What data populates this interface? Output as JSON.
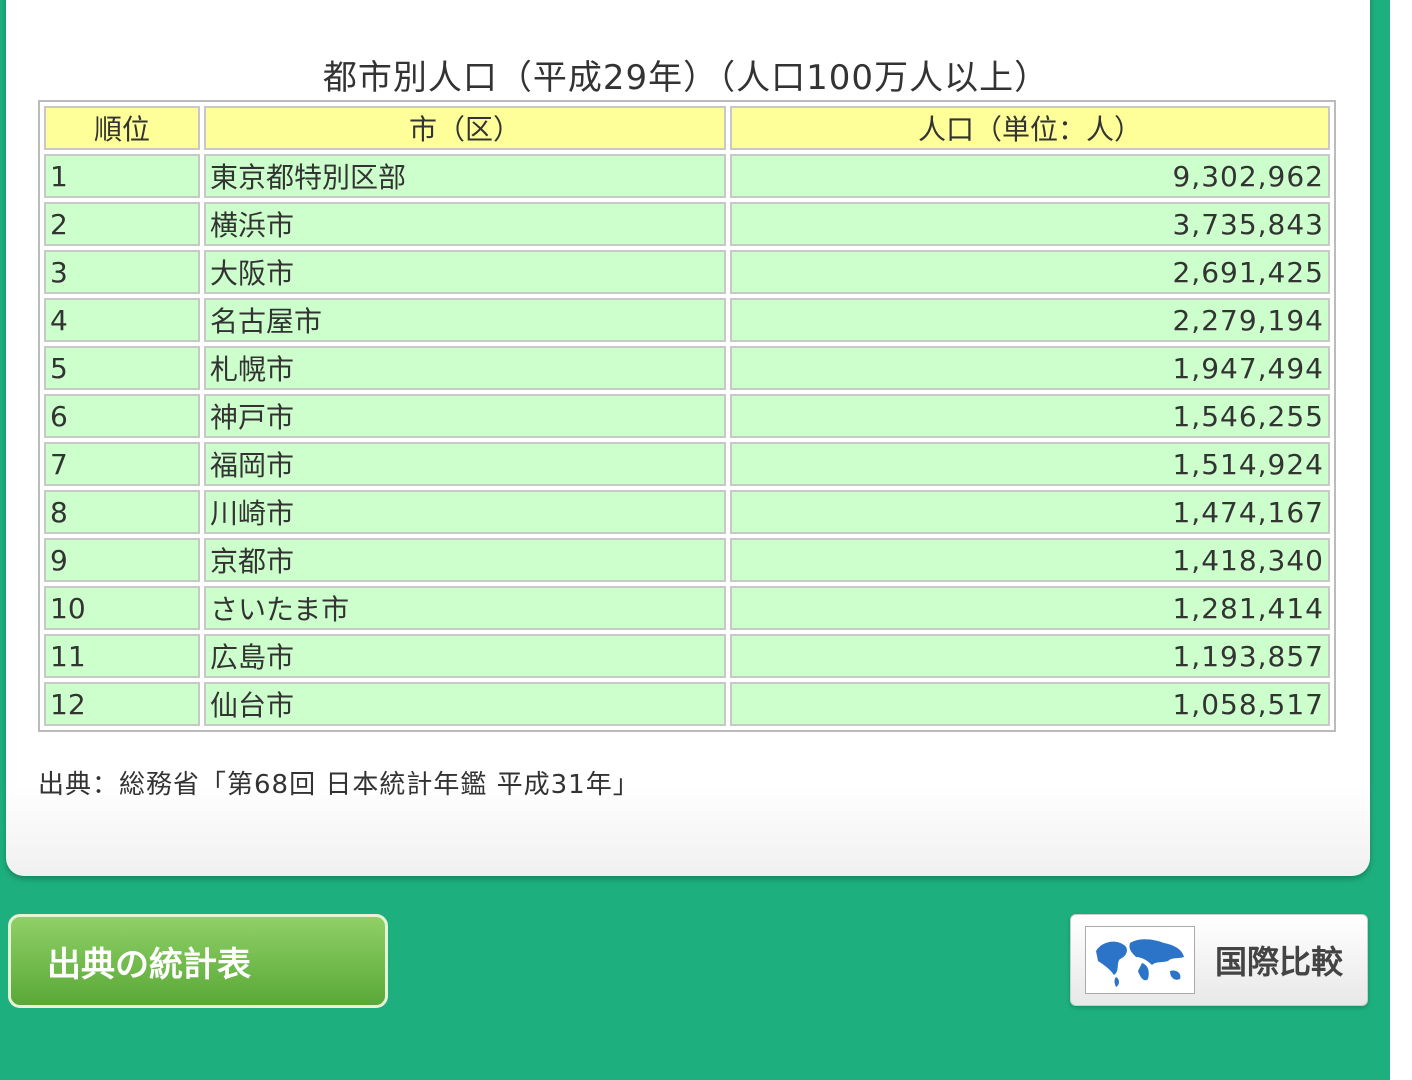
{
  "title": "都市別人口（平成29年）（人口100万人以上）",
  "table": {
    "headers": [
      "順位",
      "市（区）",
      "人口（単位：人）"
    ],
    "rows": [
      {
        "rank": "1",
        "city": "東京都特別区部",
        "population": "9,302,962"
      },
      {
        "rank": "2",
        "city": "横浜市",
        "population": "3,735,843"
      },
      {
        "rank": "3",
        "city": "大阪市",
        "population": "2,691,425"
      },
      {
        "rank": "4",
        "city": "名古屋市",
        "population": "2,279,194"
      },
      {
        "rank": "5",
        "city": "札幌市",
        "population": "1,947,494"
      },
      {
        "rank": "6",
        "city": "神戸市",
        "population": "1,546,255"
      },
      {
        "rank": "7",
        "city": "福岡市",
        "population": "1,514,924"
      },
      {
        "rank": "8",
        "city": "川崎市",
        "population": "1,474,167"
      },
      {
        "rank": "9",
        "city": "京都市",
        "population": "1,418,340"
      },
      {
        "rank": "10",
        "city": "さいたま市",
        "population": "1,281,414"
      },
      {
        "rank": "11",
        "city": "広島市",
        "population": "1,193,857"
      },
      {
        "rank": "12",
        "city": "仙台市",
        "population": "1,058,517"
      }
    ]
  },
  "source": "出典：総務省「第68回 日本統計年鑑 平成31年」",
  "buttons": {
    "source_table": "出典の統計表",
    "international": "国際比較"
  },
  "colors": {
    "background": "#1db07e",
    "header_cell": "#ffff99",
    "data_cell": "#ccffcc",
    "source_button": "#6fbb45"
  },
  "icons": {
    "international": "world-map-icon"
  }
}
